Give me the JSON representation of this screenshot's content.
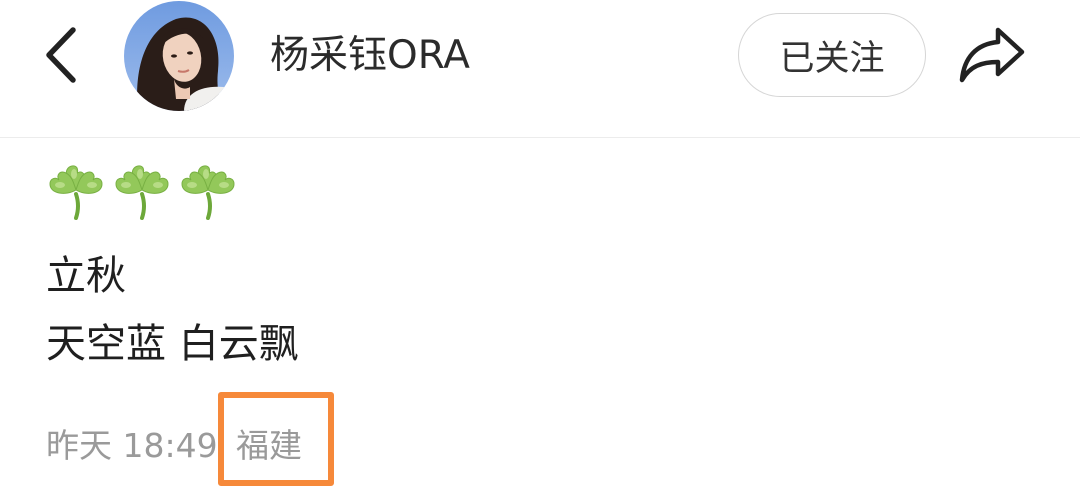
{
  "header": {
    "back_icon": "chevron-left-icon",
    "avatar_icon": "user-avatar",
    "username": "杨采钰ORA",
    "follow_label": "已关注",
    "share_icon": "share-arrow-icon"
  },
  "post": {
    "emoji": [
      "☘️",
      "☘️",
      "☘️"
    ],
    "line1": "立秋",
    "line2": "天空蓝 白云飘",
    "time": "昨天 18:49",
    "location": "福建"
  },
  "colors": {
    "highlight": "#f6893a",
    "meta_text": "#9a9a9a",
    "clover": "#8cc63f"
  }
}
